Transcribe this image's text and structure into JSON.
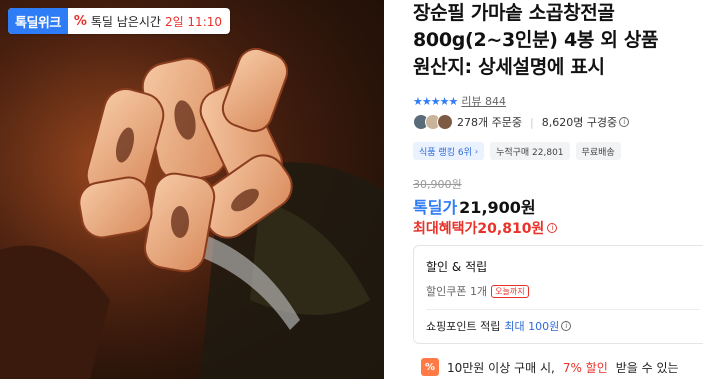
{
  "badge": {
    "logo_text": "톡딜위크",
    "timer_label": "톡딜 남은시간",
    "timer_value": "2일 11:10",
    "percent_icon": "%"
  },
  "product": {
    "title_lines": [
      "장순필 가마솥 소곱창전골",
      "800g(2~3인분) 4봉 외 상품",
      "원산지: 상세설명에 표시"
    ],
    "stars": "★★★★★",
    "review_text": "리뷰 844",
    "order_count": "278개 주문중",
    "viewer_count": "8,620명 구경중",
    "chips": [
      "식품 랭킹 6위",
      "누적구매 22,801",
      "무료배송"
    ],
    "original_price": "30,900원",
    "deal_label": "톡딜가",
    "deal_price": "21,900원",
    "max_label": "최대혜택가",
    "max_price": "20,810원"
  },
  "benefits": {
    "title": "할인 & 적립",
    "coupon_text": "할인쿠폰 1개",
    "coupon_tag": "오늘까지",
    "point_label": "쇼핑포인트 적립",
    "point_value": "최대 100원"
  },
  "promo": {
    "icon_text": "%",
    "text_before": "10만원 이상 구매 시,",
    "text_highlight": "7% 할인",
    "text_after": "받을 수 있는"
  },
  "colors": {
    "accent_blue": "#2e7cf6",
    "accent_red": "#e8322a"
  }
}
